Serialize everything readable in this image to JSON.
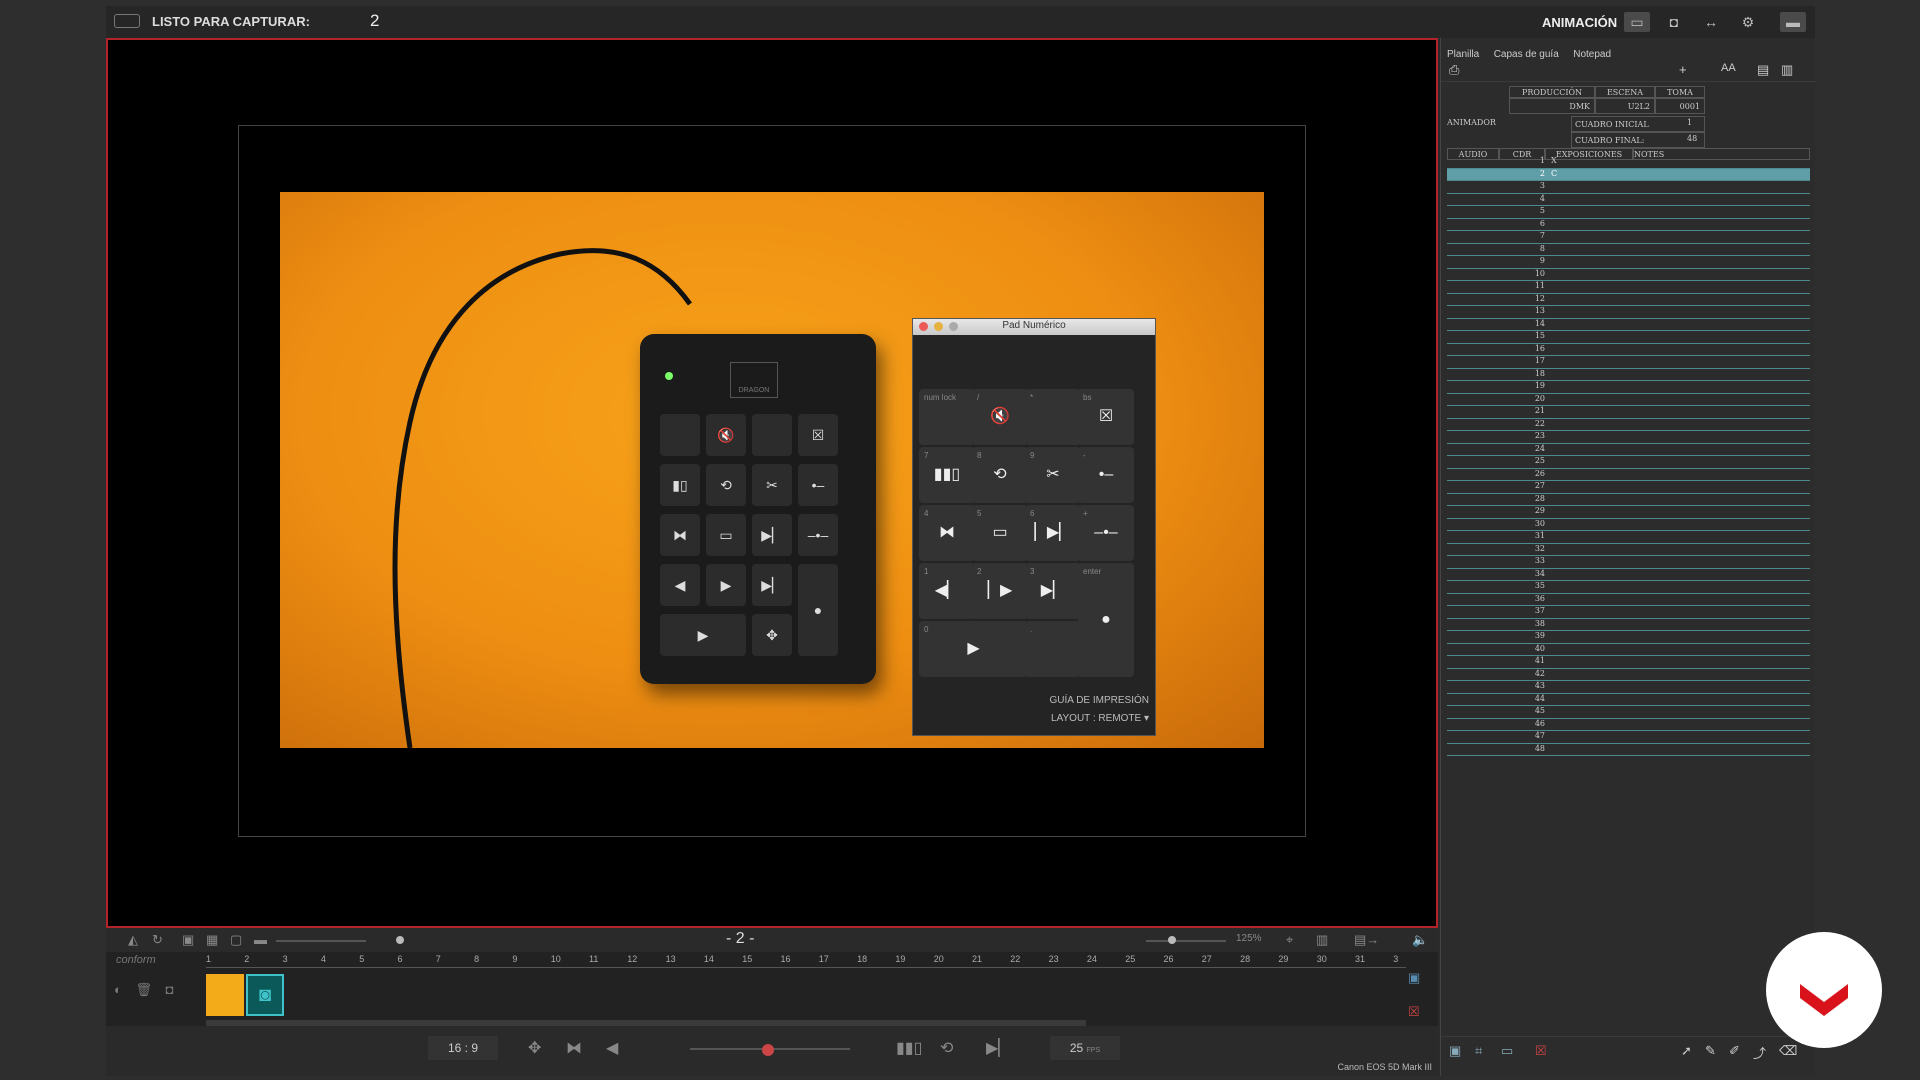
{
  "topbar": {
    "capture_label": "LISTO PARA CAPTURAR:",
    "capture_count": "2",
    "mode_label": "ANIMACIÓN"
  },
  "pad_window": {
    "title": "Pad Numérico",
    "footer_line1": "GUÍA DE IMPRESIÓN",
    "footer_line2": "LAYOUT : REMOTE ▾",
    "keys": [
      {
        "label": "num lock",
        "icon": ""
      },
      {
        "label": "/",
        "icon": "🔇"
      },
      {
        "label": "*",
        "icon": ""
      },
      {
        "label": "bs",
        "icon": "☒"
      },
      {
        "label": "7",
        "icon": "▮▮▯"
      },
      {
        "label": "8",
        "icon": "⟲"
      },
      {
        "label": "9",
        "icon": "✂"
      },
      {
        "label": "-",
        "icon": "•–"
      },
      {
        "label": "4",
        "icon": "⧓"
      },
      {
        "label": "5",
        "icon": "▭"
      },
      {
        "label": "6",
        "icon": "▏▶▏"
      },
      {
        "label": "+",
        "icon": "–•–"
      },
      {
        "label": "1",
        "icon": "◀▏"
      },
      {
        "label": "2",
        "icon": "▏▶"
      },
      {
        "label": "3",
        "icon": "▶▏"
      },
      {
        "label": "enter",
        "icon": "●"
      },
      {
        "label": "0",
        "icon": "▶"
      },
      {
        "label": ".",
        "icon": ""
      }
    ]
  },
  "viewer_toolbar": {
    "frame": "- 2 -",
    "zoom": "125%"
  },
  "timeline": {
    "track_label": "conform",
    "ruler": [
      "1",
      "2",
      "3",
      "4",
      "5",
      "6",
      "7",
      "8",
      "9",
      "10",
      "11",
      "12",
      "13",
      "14",
      "15",
      "16",
      "17",
      "18",
      "19",
      "20",
      "21",
      "22",
      "23",
      "24",
      "25",
      "26",
      "27",
      "28",
      "29",
      "30",
      "31",
      "3"
    ]
  },
  "transport": {
    "aspect": "16 : 9",
    "fps_value": "25",
    "fps_unit": "FPS",
    "camera": "Canon EOS 5D Mark III"
  },
  "side_panel": {
    "tabs": [
      "Planilla",
      "Capas de guía",
      "Notepad"
    ],
    "headers": {
      "produccion": "PRODUCCIÓN",
      "escena": "ESCENA",
      "toma": "TOMA",
      "produccion_val": "DMK",
      "escena_val": "U2L2",
      "toma_val": "0001",
      "animador": "ANIMADOR",
      "cuadro_inicial": "CUADRO INICIAL",
      "cuadro_inicial_val": "1",
      "cuadro_final": "CUADRO FINAL:",
      "cuadro_final_val": "48"
    },
    "columns": [
      "AUDIO",
      "CDR",
      "EXPOSICIONES",
      "NOTES"
    ],
    "rows": [
      "1",
      "2",
      "3",
      "4",
      "5",
      "6",
      "7",
      "8",
      "9",
      "10",
      "11",
      "12",
      "13",
      "14",
      "15",
      "16",
      "17",
      "18",
      "19",
      "20",
      "21",
      "22",
      "23",
      "24",
      "25",
      "26",
      "27",
      "28",
      "29",
      "30",
      "31",
      "32",
      "33",
      "34",
      "35",
      "36",
      "37",
      "38",
      "39",
      "40",
      "41",
      "42",
      "43",
      "44",
      "45",
      "46",
      "47",
      "48"
    ],
    "row1_exposure": "X",
    "row2_exposure": "C"
  }
}
